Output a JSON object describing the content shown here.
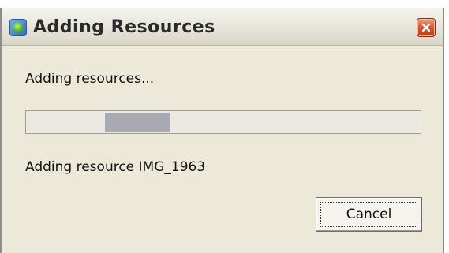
{
  "window": {
    "title": "Adding Resources",
    "app_icon": "app-leaf-icon",
    "close_icon": "close-icon",
    "close_color": "#d9542e"
  },
  "dialog": {
    "status_text": "Adding resources...",
    "detail_text": "Adding resource IMG_1963",
    "progress": {
      "style": "indeterminate",
      "segment_start_fraction": 0.2,
      "segment_end_fraction": 0.365,
      "fill_color": "#a9a9b2"
    },
    "cancel_label": "Cancel"
  }
}
